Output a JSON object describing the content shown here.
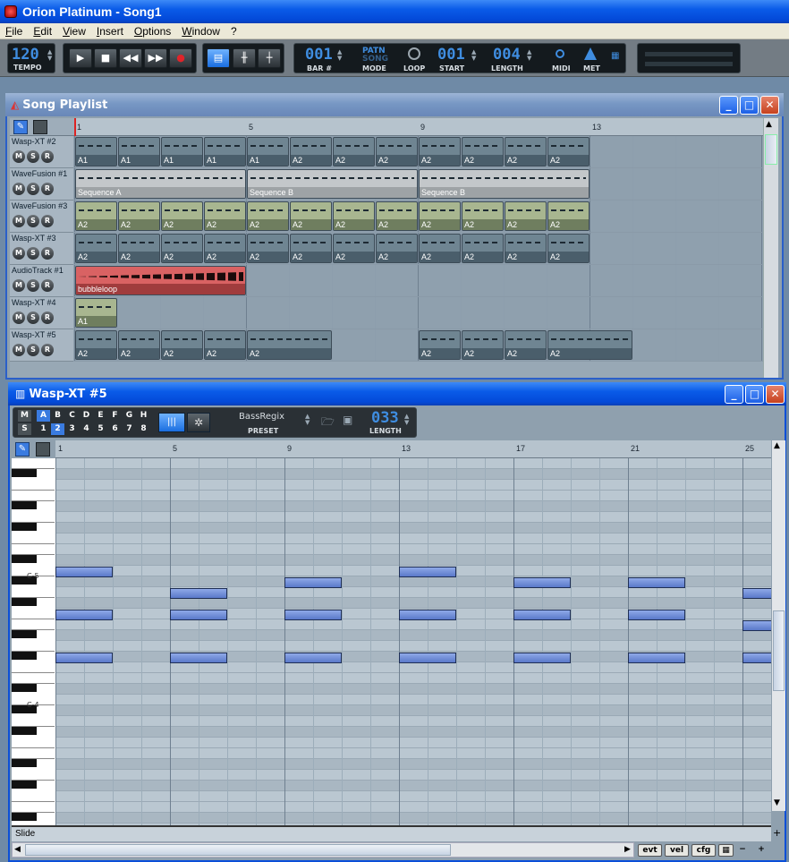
{
  "app": {
    "title": "Orion Platinum - Song1"
  },
  "menu": [
    "File",
    "Edit",
    "View",
    "Insert",
    "Options",
    "Window",
    "?"
  ],
  "transport": {
    "tempo": "120",
    "tempo_label": "TEMPO",
    "bar": "001",
    "bar_label": "BAR #",
    "mode_top": "PATN",
    "mode_bottom": "SONG",
    "mode_label": "MODE",
    "loop_label": "LOOP",
    "start": "001",
    "start_label": "START",
    "length": "004",
    "length_label": "LENGTH",
    "midi_label": "MIDI",
    "met_label": "MET"
  },
  "playlist": {
    "title": "Song Playlist",
    "ruler": [
      "1",
      "5",
      "9",
      "13"
    ],
    "tracks": [
      {
        "name": "Wasp-XT #2",
        "blocks": [
          [
            "A1",
            0
          ],
          [
            "A1",
            1
          ],
          [
            "A1",
            2
          ],
          [
            "A1",
            3
          ],
          [
            "A1",
            4
          ],
          [
            "A2",
            5
          ],
          [
            "A2",
            6
          ],
          [
            "A2",
            7
          ],
          [
            "A2",
            8
          ],
          [
            "A2",
            9
          ],
          [
            "A2",
            10
          ],
          [
            "A2",
            11
          ]
        ],
        "style": "teal"
      },
      {
        "name": "WaveFusion #1",
        "blocks": [
          [
            "Sequence A",
            0,
            4
          ],
          [
            "Sequence B",
            4,
            4
          ],
          [
            "Sequence B",
            8,
            4
          ]
        ],
        "style": "grey"
      },
      {
        "name": "WaveFusion #3",
        "blocks": [
          [
            "A2",
            0
          ],
          [
            "A2",
            1
          ],
          [
            "A2",
            2
          ],
          [
            "A2",
            3
          ],
          [
            "A2",
            4
          ],
          [
            "A2",
            5
          ],
          [
            "A2",
            6
          ],
          [
            "A2",
            7
          ],
          [
            "A2",
            8
          ],
          [
            "A2",
            9
          ],
          [
            "A2",
            10
          ],
          [
            "A2",
            11
          ]
        ],
        "style": "green"
      },
      {
        "name": "Wasp-XT #3",
        "blocks": [
          [
            "A2",
            0
          ],
          [
            "A2",
            1
          ],
          [
            "A2",
            2
          ],
          [
            "A2",
            3
          ],
          [
            "A2",
            4
          ],
          [
            "A2",
            5
          ],
          [
            "A2",
            6
          ],
          [
            "A2",
            7
          ],
          [
            "A2",
            8
          ],
          [
            "A2",
            9
          ],
          [
            "A2",
            10
          ],
          [
            "A2",
            11
          ]
        ],
        "style": "teal"
      },
      {
        "name": "AudioTrack #1",
        "blocks": [
          [
            "bubbleloop",
            0,
            4
          ]
        ],
        "style": "red"
      },
      {
        "name": "Wasp-XT #4",
        "blocks": [
          [
            "A1",
            0
          ]
        ],
        "style": "green"
      },
      {
        "name": "Wasp-XT #5",
        "blocks": [
          [
            "A2",
            0
          ],
          [
            "A2",
            1
          ],
          [
            "A2",
            2
          ],
          [
            "A2",
            3
          ],
          [
            "A2",
            4,
            2
          ],
          [
            "A2",
            8
          ],
          [
            "A2",
            9
          ],
          [
            "A2",
            10
          ],
          [
            "A2",
            11,
            2
          ]
        ],
        "style": "teal"
      }
    ],
    "msr": [
      "M",
      "S",
      "R"
    ]
  },
  "editor": {
    "title": "Wasp-XT #5",
    "ms": [
      "M",
      "S"
    ],
    "patterns": [
      "A",
      "B",
      "C",
      "D",
      "E",
      "F",
      "G",
      "H"
    ],
    "numbers": [
      "1",
      "2",
      "3",
      "4",
      "5",
      "6",
      "7",
      "8"
    ],
    "preset": "BassRegix",
    "preset_label": "PRESET",
    "length": "033",
    "length_label": "LENGTH",
    "ruler": [
      "1",
      "5",
      "9",
      "13",
      "17",
      "21",
      "25"
    ],
    "key_c5": "C-5",
    "key_c4": "C-4",
    "lane_label": "Slide",
    "bottom_buttons": [
      "evt",
      "vel",
      "cfg"
    ]
  }
}
